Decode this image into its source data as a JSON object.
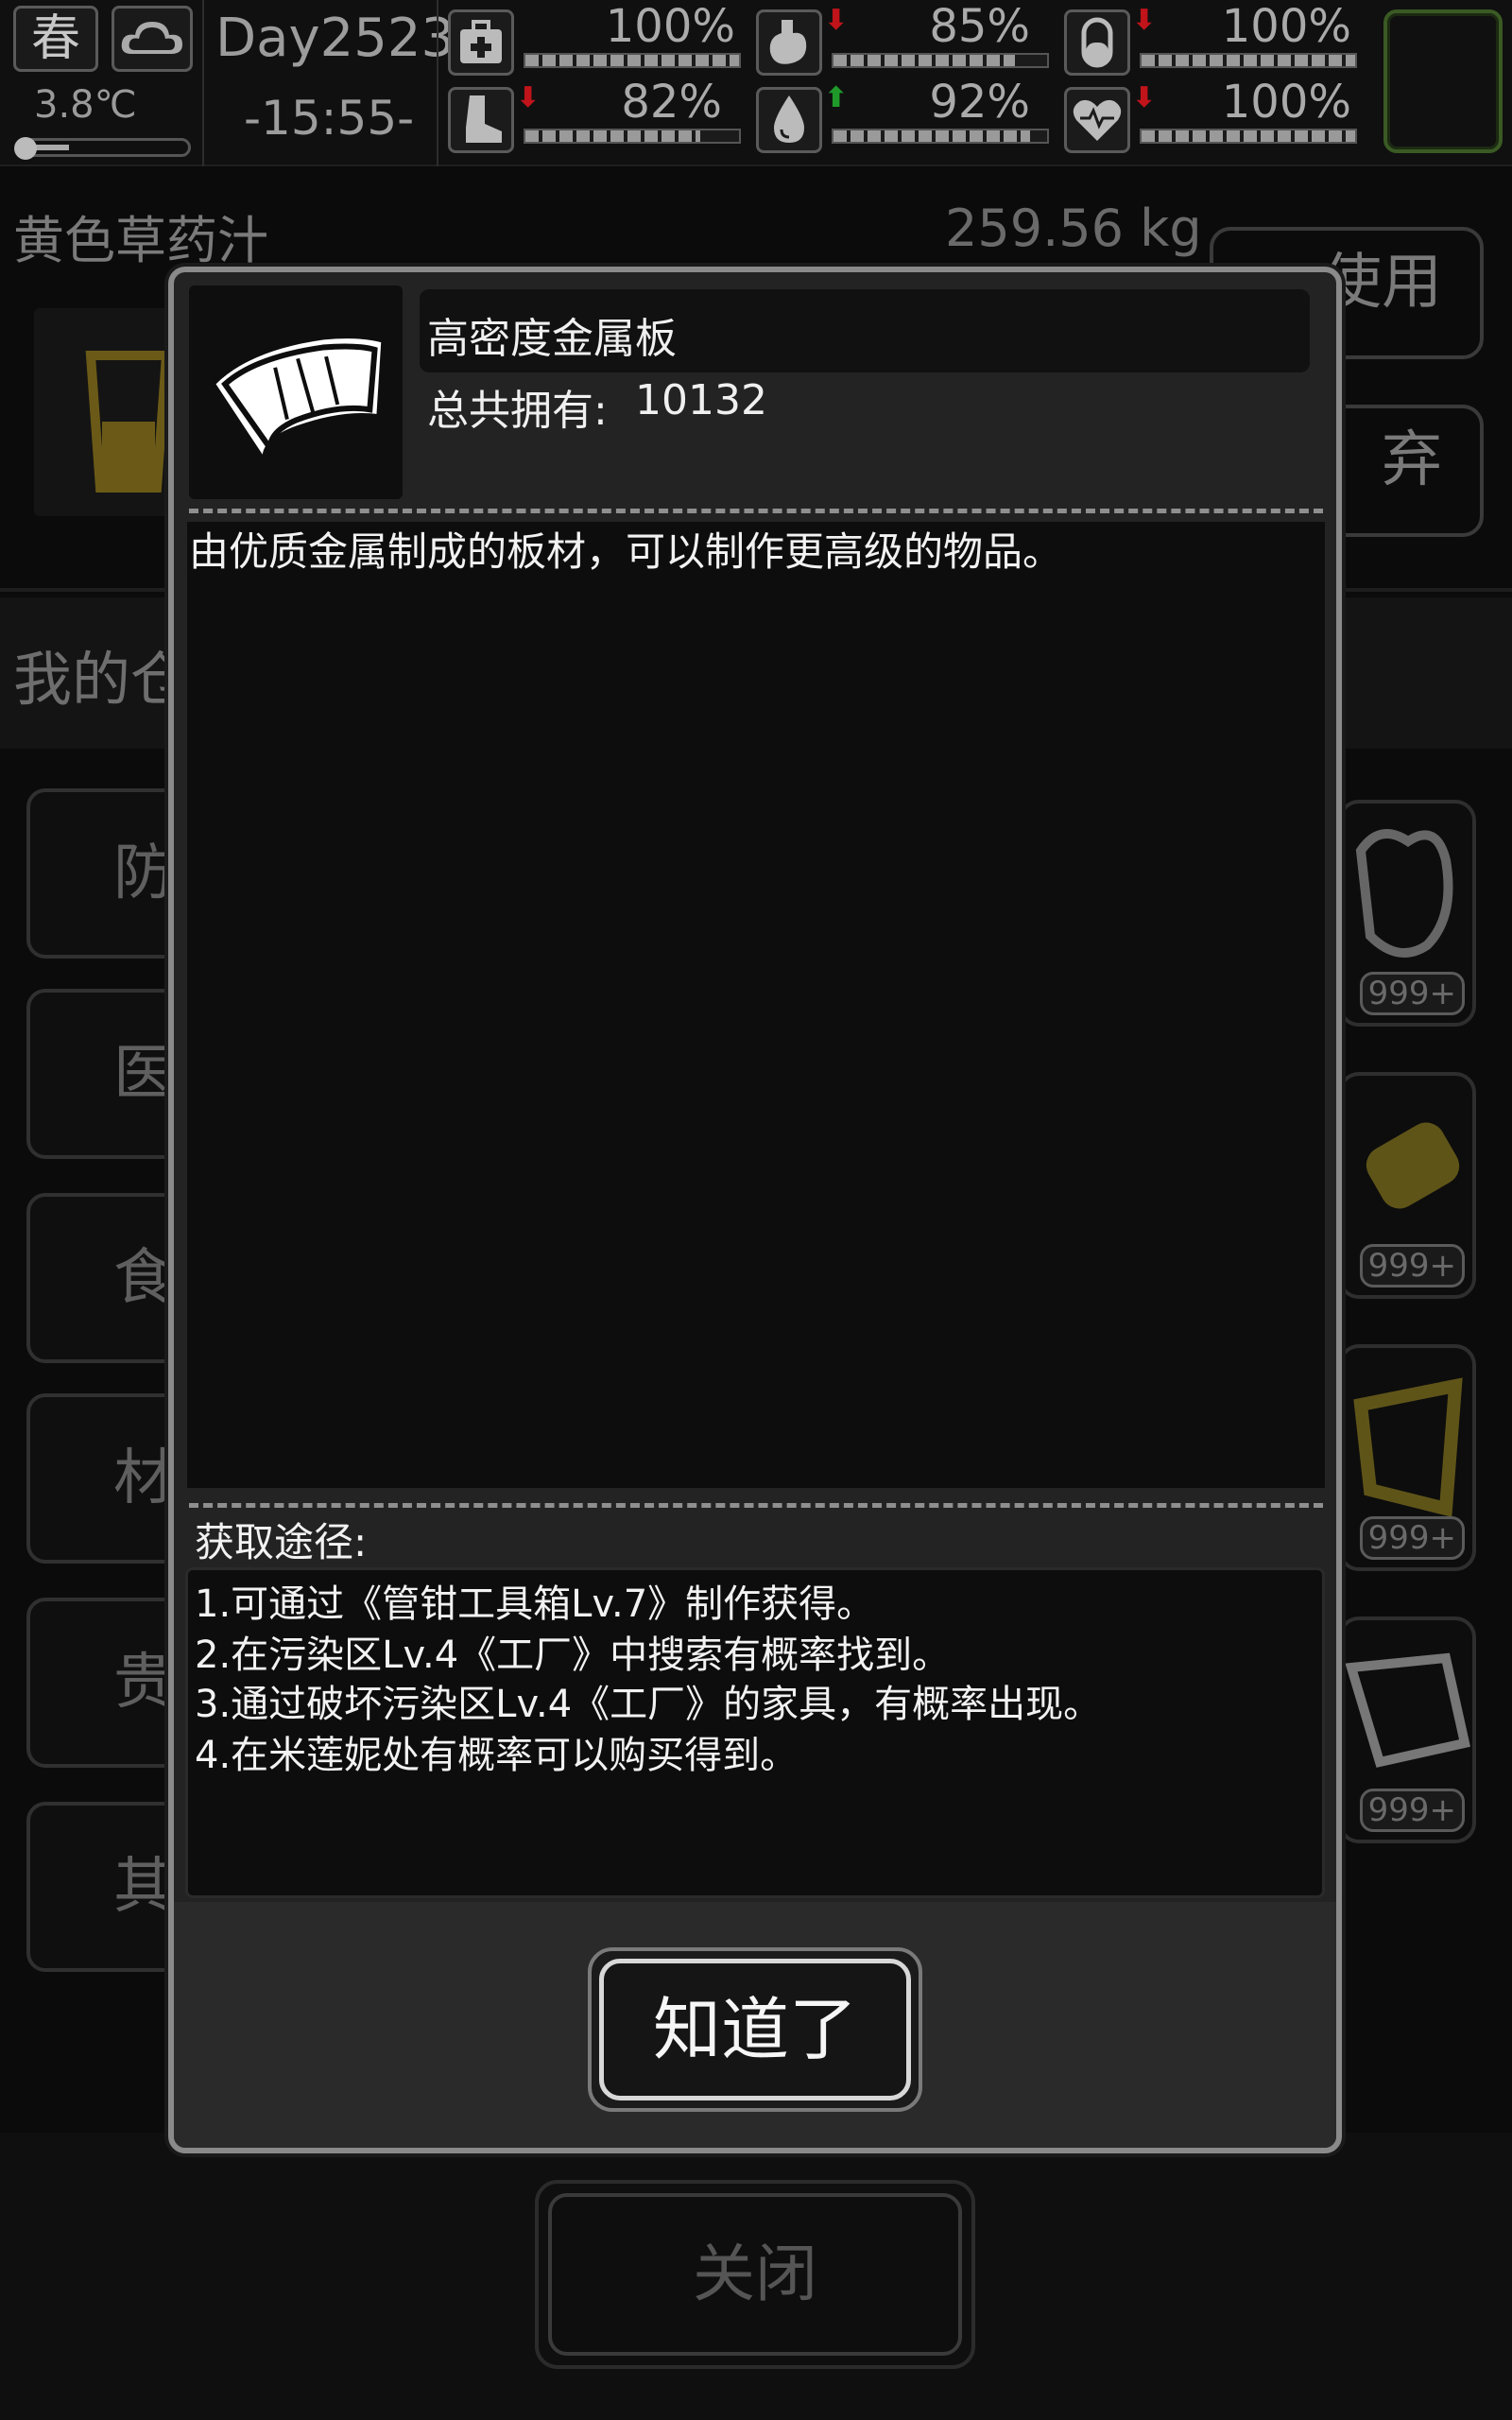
{
  "status_bar": {
    "season": "春",
    "weather_icon": "cloud-icon",
    "temperature": "3.8℃",
    "temperature_level": 0.25,
    "day": "Day2523",
    "time": "-15:55-",
    "stats": [
      {
        "icon": "medkit-icon",
        "pct": "100%",
        "value": 1.0,
        "arrow": ""
      },
      {
        "icon": "stomach-icon",
        "pct": "85%",
        "value": 0.85,
        "arrow": "down"
      },
      {
        "icon": "pill-icon",
        "pct": "100%",
        "value": 1.0,
        "arrow": "down"
      },
      {
        "icon": "boot-icon",
        "pct": "82%",
        "value": 0.82,
        "arrow": "down"
      },
      {
        "icon": "water-drop-icon",
        "pct": "92%",
        "value": 0.92,
        "arrow": "up"
      },
      {
        "icon": "heart-icon",
        "pct": "100%",
        "value": 1.0,
        "arrow": "down"
      }
    ],
    "colors": {
      "arrow_down": "#c0141a",
      "arrow_up": "#1f9a2a",
      "corner_border": "#3a5a24"
    }
  },
  "background": {
    "selected_item": "黄色草药汁",
    "weight": "259.56 kg",
    "use_button": "使用",
    "discard_button": "弃",
    "section_title": "我的仓库",
    "categories": [
      "防",
      "医",
      "食",
      "材",
      "贵",
      "其"
    ],
    "slot_tags": [
      "999+",
      "999+",
      "999+",
      "999+"
    ],
    "close_button": "关闭"
  },
  "dialog": {
    "item_icon": "metal-plate-icon",
    "item_name": "高密度金属板",
    "owned_label": "总共拥有:",
    "owned_count": "10132",
    "description": "由优质金属制成的板材，可以制作更高级的物品。",
    "source_title": "获取途径:",
    "sources": [
      "1.可通过《管钳工具箱Lv.7》制作获得。",
      "2.在污染区Lv.4《工厂》中搜索有概率找到。",
      "3.通过破坏污染区Lv.4《工厂》的家具，有概率出现。",
      "4.在米莲妮处有概率可以购买得到。"
    ],
    "ok_button": "知道了"
  }
}
